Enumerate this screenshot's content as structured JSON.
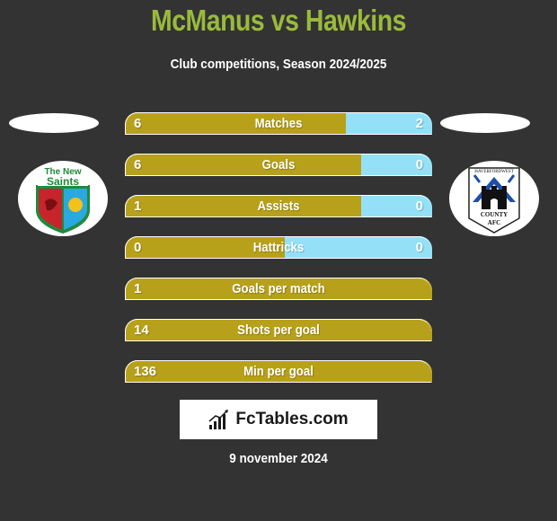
{
  "header": {
    "title": "McManus vs Hawkins",
    "subtitle": "Club competitions, Season 2024/2025"
  },
  "players": {
    "left": {
      "name": "McManus",
      "club_badge": "the-new-saints-badge",
      "club_badge_text": [
        "The New",
        "Saints"
      ]
    },
    "right": {
      "name": "Hawkins",
      "club_badge": "haverfordwest-county-afc-badge",
      "club_badge_text": [
        "HAVERFORDWEST",
        "COUNTY",
        "AFC"
      ]
    }
  },
  "colors": {
    "background": "#333333",
    "title": "#9aba3c",
    "left_bar": "#b8a11a",
    "right_bar": "#94e1f7"
  },
  "stats": [
    {
      "label": "Matches",
      "left": "6",
      "right": "2",
      "left_share": 0.72
    },
    {
      "label": "Goals",
      "left": "6",
      "right": "0",
      "left_share": 0.77
    },
    {
      "label": "Assists",
      "left": "1",
      "right": "0",
      "left_share": 0.77
    },
    {
      "label": "Hattricks",
      "left": "0",
      "right": "0",
      "left_share": 0.52
    },
    {
      "label": "Goals per match",
      "left": "1",
      "right": null,
      "left_share": 1
    },
    {
      "label": "Shots per goal",
      "left": "14",
      "right": null,
      "left_share": 1
    },
    {
      "label": "Min per goal",
      "left": "136",
      "right": null,
      "left_share": 1
    }
  ],
  "footer": {
    "logo_text": "FcTables.com",
    "logo_icon": "bar-chart-icon",
    "date": "9 november 2024"
  }
}
